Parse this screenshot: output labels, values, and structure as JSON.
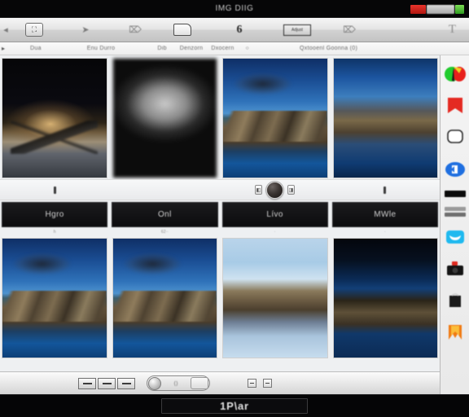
{
  "window": {
    "title": "IMG DIIG",
    "controls": {
      "close": "close",
      "middle_label": "",
      "maximize": "maximize"
    }
  },
  "toolbar": {
    "items": [
      {
        "name": "back-button",
        "glyph": "◂",
        "kind": "plain"
      },
      {
        "name": "library-button",
        "glyph": "⊞",
        "kind": "box"
      },
      {
        "name": "share-button",
        "glyph": "➤",
        "kind": "plain"
      },
      {
        "name": "rotate-button",
        "glyph": "↶",
        "kind": "plain"
      },
      {
        "name": "folder-button",
        "glyph": "",
        "kind": "folder"
      },
      {
        "name": "edit-button",
        "glyph": "6",
        "kind": "six"
      },
      {
        "name": "adjust-button",
        "glyph": "Adjust",
        "kind": "wide"
      },
      {
        "name": "effects-button",
        "glyph": "↶",
        "kind": "plain"
      },
      {
        "name": "text-button",
        "glyph": "T",
        "kind": "tee"
      }
    ]
  },
  "menubar": {
    "arrow": "▸",
    "items": [
      "Dua",
      "Enu Durro",
      "Dib",
      "Denzorn",
      "Dxocern",
      "○",
      "Qxtooenl Goonna (0)"
    ]
  },
  "sidebar": {
    "items": [
      {
        "name": "sidebar-color-wheel-icon",
        "label": "color-wheel"
      },
      {
        "name": "sidebar-bookmark-icon",
        "label": "bookmark"
      },
      {
        "name": "sidebar-frame-icon",
        "label": "frame"
      },
      {
        "name": "sidebar-sync-icon",
        "label": "sync"
      },
      {
        "name": "sidebar-bar-icon",
        "label": "bar"
      },
      {
        "name": "sidebar-strip-icon",
        "label": "strip"
      },
      {
        "name": "sidebar-cloud-icon",
        "label": "cloud"
      },
      {
        "name": "sidebar-camera-icon",
        "label": "camera"
      },
      {
        "name": "sidebar-bag-icon",
        "label": "bag"
      },
      {
        "name": "sidebar-flame-icon",
        "label": "flame"
      }
    ]
  },
  "grid": {
    "top_row": [
      {
        "name": "photo-sunset-lake",
        "style": "t1",
        "caption": ""
      },
      {
        "name": "photo-blurred-gray",
        "style": "t2",
        "caption": ""
      },
      {
        "name": "photo-mountain-clouds",
        "style": "mt",
        "caption": ""
      },
      {
        "name": "photo-mountain-blue",
        "style": "mt-mid",
        "caption": ""
      }
    ],
    "bottom_row": [
      {
        "name": "photo-ridge-water",
        "style": "mt",
        "caption": "h"
      },
      {
        "name": "photo-peaks-valley",
        "style": "mt",
        "caption": "62··"
      },
      {
        "name": "photo-reflection-pale",
        "style": "mt-light",
        "caption": "·"
      },
      {
        "name": "photo-night-ridge",
        "style": "mt-dark",
        "caption": "·"
      }
    ]
  },
  "thumbstrip": {
    "jog": {
      "left_glyph": "◧",
      "right_glyph": "◨"
    },
    "markers": [
      "·",
      "·",
      "·",
      "·"
    ]
  },
  "labels": {
    "chips": [
      "Hgro",
      "Onl",
      "Lívo",
      "MWle"
    ]
  },
  "bottom_toolbar": {
    "view_mode_segments": [
      "list-view",
      "split-view",
      "grid-view"
    ],
    "zoom_label": "⟨⟩",
    "right_buttons": [
      "collapse-button",
      "expand-button"
    ]
  },
  "statusbar": {
    "text": "1P\\ar"
  },
  "colors": {
    "accent_blue": "#1a6fd4",
    "close_red": "#e8342c",
    "maximize_green": "#4fbf35",
    "chrome_light": "#e8e8e8",
    "chrome_dark": "#060607"
  }
}
